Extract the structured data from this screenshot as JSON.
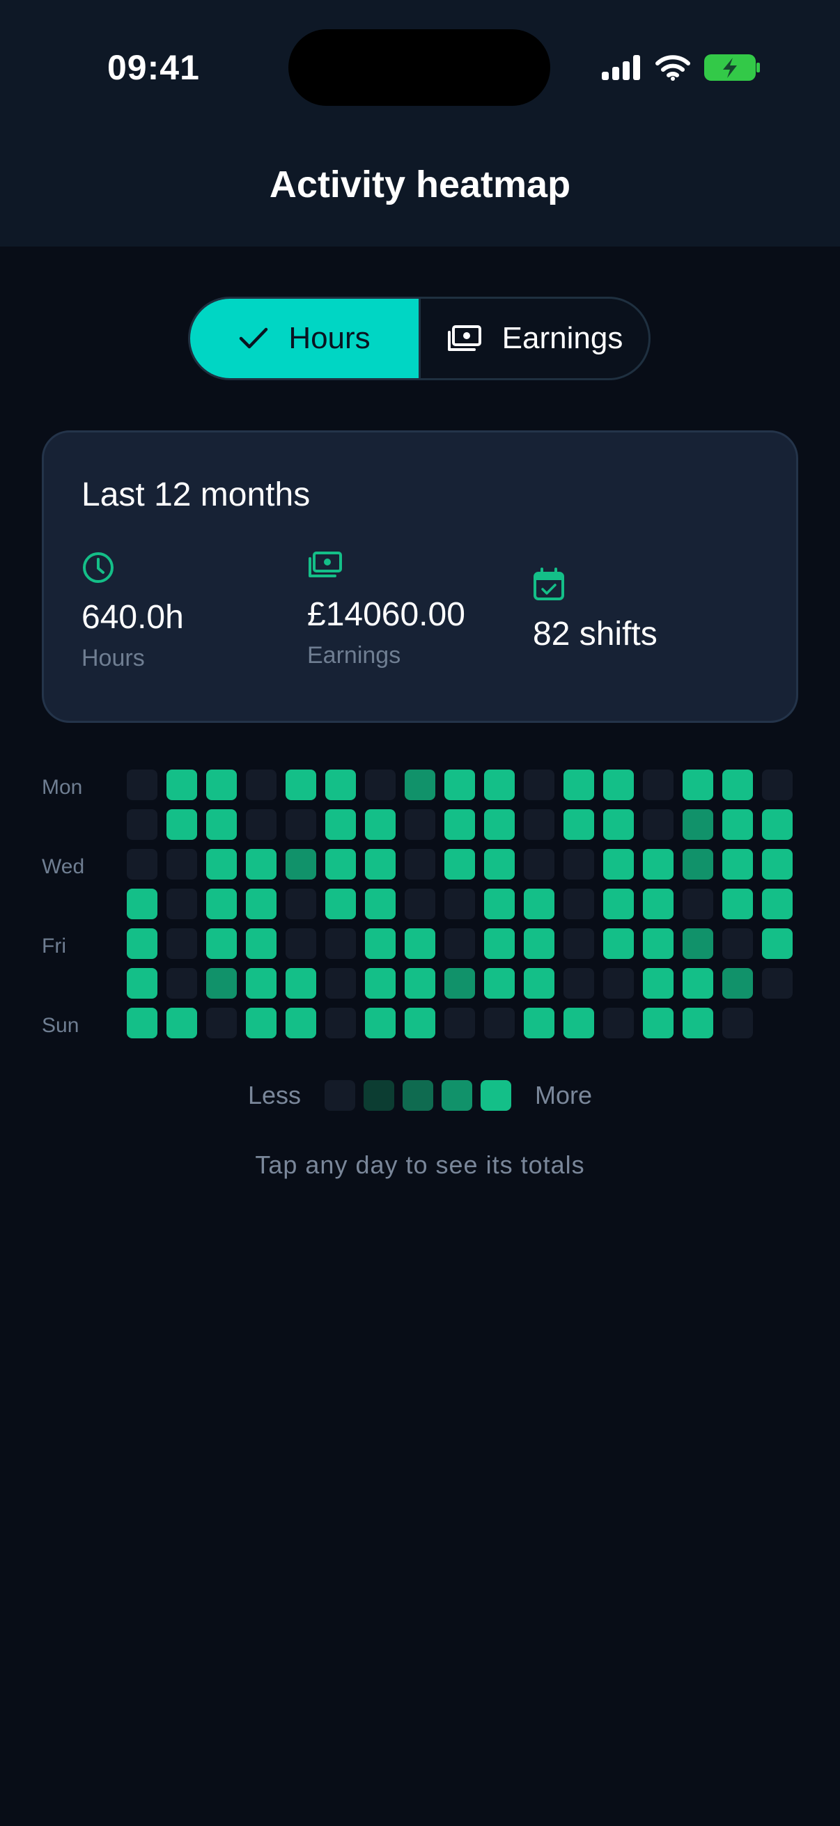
{
  "status_bar": {
    "time": "09:41"
  },
  "header": {
    "title": "Activity heatmap"
  },
  "toggle": {
    "options": [
      {
        "label": "Hours",
        "icon": "check-icon",
        "active": true
      },
      {
        "label": "Earnings",
        "icon": "cash-icon",
        "active": false
      }
    ]
  },
  "summary": {
    "title": "Last 12 months",
    "stats": [
      {
        "value": "640.0h",
        "label": "Hours",
        "icon": "clock-icon"
      },
      {
        "value": "£14060.00",
        "label": "Earnings",
        "icon": "cash-icon"
      },
      {
        "value": "82 shifts",
        "label": "",
        "icon": "calendar-check-icon"
      }
    ]
  },
  "heatmap": {
    "day_labels": [
      "Mon",
      "",
      "Wed",
      "",
      "Fri",
      "",
      "Sun"
    ],
    "rows": [
      [
        0,
        4,
        4,
        0,
        4,
        4,
        0,
        3,
        4,
        4,
        0,
        4,
        4,
        0,
        4,
        4,
        0
      ],
      [
        0,
        4,
        4,
        0,
        0,
        4,
        4,
        0,
        4,
        4,
        0,
        4,
        4,
        0,
        3,
        4,
        4
      ],
      [
        0,
        0,
        4,
        4,
        3,
        4,
        4,
        0,
        4,
        4,
        0,
        0,
        4,
        4,
        3,
        4,
        4
      ],
      [
        4,
        0,
        4,
        4,
        0,
        4,
        4,
        0,
        0,
        4,
        4,
        0,
        4,
        4,
        0,
        4,
        4
      ],
      [
        4,
        0,
        4,
        4,
        0,
        0,
        4,
        4,
        0,
        4,
        4,
        0,
        4,
        4,
        3,
        0,
        4
      ],
      [
        4,
        0,
        3,
        4,
        4,
        0,
        4,
        4,
        3,
        4,
        4,
        0,
        0,
        4,
        4,
        3,
        0
      ],
      [
        4,
        4,
        0,
        4,
        4,
        0,
        4,
        4,
        0,
        0,
        4,
        4,
        0,
        4,
        4,
        0,
        null
      ]
    ],
    "level_colors": [
      "#141b28",
      "#0c3d32",
      "#0f6b50",
      "#11926a",
      "#14bf88"
    ]
  },
  "legend": {
    "less": "Less",
    "more": "More"
  },
  "hint": "Tap any day to see its totals"
}
